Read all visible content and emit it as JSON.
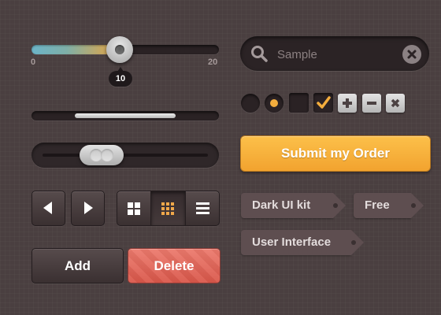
{
  "slider": {
    "min_label": "0",
    "max_label": "20",
    "value_label": "10",
    "value": 10,
    "min": 0,
    "max": 20
  },
  "progress": {
    "start_fraction": 0.23,
    "end_fraction": 0.77
  },
  "toggle": {
    "state": "middle"
  },
  "nav_buttons": {
    "prev_icon": "arrow-left-icon",
    "next_icon": "arrow-right-icon"
  },
  "view_toggle": {
    "options": [
      "grid-large-icon",
      "grid-small-icon",
      "list-icon"
    ],
    "selected": "grid-small-icon"
  },
  "actions": {
    "add_label": "Add",
    "delete_label": "Delete"
  },
  "search": {
    "placeholder": "Sample",
    "value": ""
  },
  "form_controls": {
    "radio_1_checked": false,
    "radio_2_checked": true,
    "checkbox_1_checked": false,
    "checkbox_2_checked": true,
    "icons": [
      "plus-icon",
      "minus-icon",
      "x-icon"
    ]
  },
  "submit": {
    "label": "Submit my Order"
  },
  "tags": [
    "Dark UI kit",
    "Free",
    "User Interface"
  ],
  "colors": {
    "background": "#4a3f40",
    "accent_orange": "#f2a32f",
    "delete_red": "#e16759",
    "tag_bg": "#5e4e50"
  }
}
